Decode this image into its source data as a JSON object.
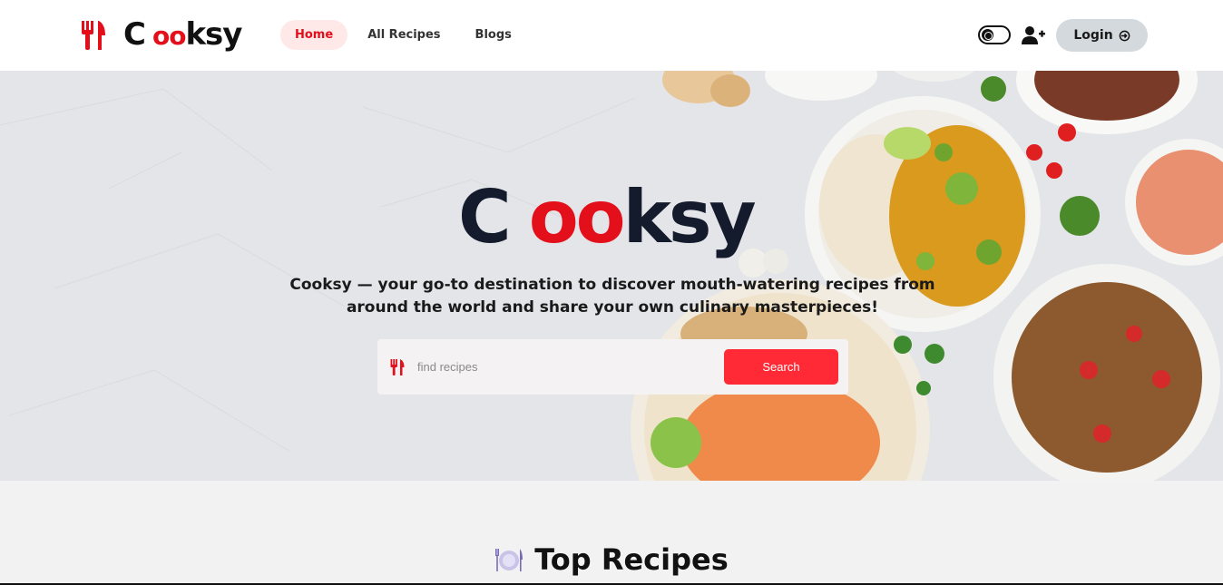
{
  "brand": {
    "name_c": "C",
    "name_oo": "oo",
    "name_rest": "ksy",
    "accent": "#e3101c"
  },
  "nav": {
    "links": [
      {
        "label": "Home",
        "active": true
      },
      {
        "label": "All Recipes",
        "active": false
      },
      {
        "label": "Blogs",
        "active": false
      }
    ],
    "theme_toggle_icon": "theme-toggle-icon",
    "add_user_icon": "user-plus-icon",
    "login_label": "Login",
    "login_icon": "login-icon"
  },
  "hero": {
    "title_c": "C",
    "title_oo": "oo",
    "title_rest": "ksy",
    "tagline": "Cooksy — your go-to destination to discover mouth-watering recipes from around the world and share your own culinary masterpieces!",
    "search": {
      "icon": "fork-knife-icon",
      "placeholder": "find recipes",
      "value": "",
      "button_label": "Search",
      "button_color": "#ff2a35"
    }
  },
  "section": {
    "icon": "plate-icon",
    "title": "Top Recipes"
  }
}
